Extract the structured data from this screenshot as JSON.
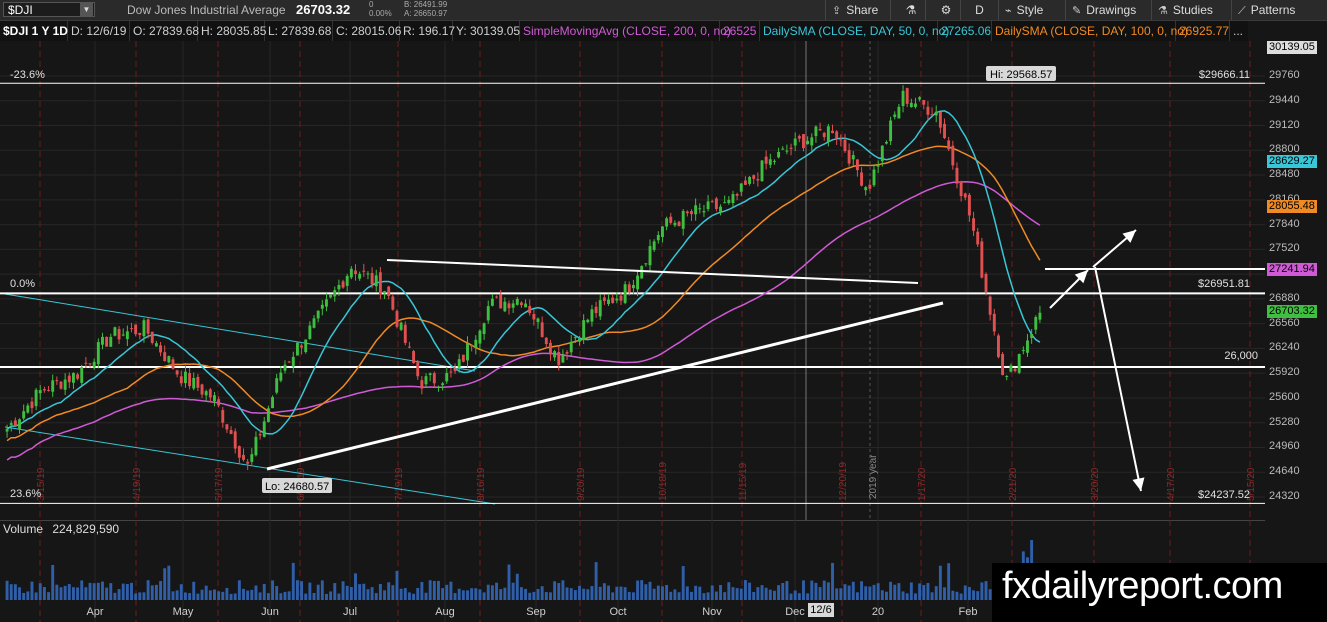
{
  "toolbar": {
    "symbol": "$DJI",
    "name": "Dow Jones Industrial Average",
    "last": "26703.32",
    "change": "0",
    "change_pct": "0.00%",
    "bid": "B: 26491.99",
    "ask": "A: 26650.97",
    "share": "Share",
    "timeframe": "D",
    "style": "Style",
    "drawings": "Drawings",
    "studies": "Studies",
    "patterns": "Patterns"
  },
  "infobar": {
    "title": "$DJI 1 Y 1D",
    "date": "D: 12/6/19",
    "open": "O: 27839.68",
    "high": "H: 28035.85",
    "low": "L: 27839.68",
    "close": "C: 28015.06",
    "range": "R: 196.17",
    "y": "Y: 30139.05",
    "sma200_label": "SimpleMovingAvg (CLOSE, 200, 0, no)",
    "sma200_value": "26525",
    "sma50_label": "DailySMA (CLOSE, DAY, 50, 0, no)",
    "sma50_value": "27265.06",
    "sma100_label": "DailySMA (CLOSE, DAY, 100, 0, no)",
    "sma100_value": "26925.77",
    "more": "..."
  },
  "price_axis": {
    "top_label": "30139.05",
    "ticks": [
      "29760",
      "29440",
      "29120",
      "28800",
      "28480",
      "28160",
      "27840",
      "27520",
      "27200",
      "26880",
      "26560",
      "26240",
      "25920",
      "25600",
      "25280",
      "24960",
      "24640",
      "24320"
    ],
    "sma50_tag": "28629.27",
    "sma100_tag": "28055.48",
    "sma200_tag": "27241.94",
    "last_tag": "26703.32"
  },
  "annotations": {
    "fib_top_pct": "-23.6%",
    "fib_top_val": "$29666.11",
    "fib_zero_pct": "0.0%",
    "fib_zero_val": "$26951.81",
    "level_26000": "26,000",
    "fib_bottom_pct": "23.6%",
    "fib_bottom_val": "$24237.52",
    "hi": "Hi: 29568.57",
    "lo": "Lo: 24680.57",
    "year_marker": "2019 year"
  },
  "expiry_dates": [
    "3/15/19",
    "4/19/19",
    "5/17/19",
    "6/21/19",
    "7/19/19",
    "8/16/19",
    "9/20/19",
    "10/18/19",
    "11/15/19",
    "12/20/19",
    "1/17/20",
    "2/21/20",
    "3/20/20",
    "4/17/20",
    "5/15/20"
  ],
  "months": [
    "Apr",
    "May",
    "Jun",
    "Jul",
    "Aug",
    "Sep",
    "Oct",
    "Nov",
    "Dec",
    "20",
    "Feb"
  ],
  "volume": {
    "label": "Volume",
    "value": "224,829,590"
  },
  "cursor_date": "12/6",
  "brand": "fxdailyreport.com",
  "colors": {
    "up": "#3fbf3f",
    "down": "#e05050",
    "sma50": "#39c6d6",
    "sma100": "#f08a24",
    "sma200": "#d05ad6",
    "trend": "#ffffff",
    "channel": "#39c6d6",
    "grid_red": "#6b1f1f"
  },
  "chart_data": {
    "type": "candlestick",
    "title": "$DJI 1 Y 1D",
    "ylim": [
      24200,
      30200
    ],
    "x": [
      "2019-02-27",
      "2019-03-13",
      "2019-03-27",
      "2019-04-10",
      "2019-04-24",
      "2019-05-08",
      "2019-05-22",
      "2019-06-03",
      "2019-06-17",
      "2019-07-01",
      "2019-07-15",
      "2019-07-29",
      "2019-08-12",
      "2019-08-26",
      "2019-09-09",
      "2019-09-23",
      "2019-10-03",
      "2019-10-17",
      "2019-10-31",
      "2019-11-14",
      "2019-11-28",
      "2019-12-12",
      "2019-12-26",
      "2020-01-09",
      "2020-01-23",
      "2020-02-06",
      "2020-02-12",
      "2020-02-20",
      "2020-02-24",
      "2020-02-27",
      "2020-03-02"
    ],
    "close": [
      25200,
      25700,
      25900,
      26400,
      26500,
      25900,
      25600,
      24700,
      26000,
      26600,
      27300,
      27000,
      25800,
      25900,
      26800,
      26900,
      26100,
      26700,
      27000,
      27800,
      28000,
      28100,
      28600,
      28900,
      29100,
      28300,
      29500,
      29300,
      27900,
      25800,
      26703
    ],
    "series": [
      {
        "name": "SimpleMovingAvg (CLOSE, 200, 0, no)",
        "last": 27241.94
      },
      {
        "name": "DailySMA (CLOSE, DAY, 50, 0, no)",
        "last": 28629.27
      },
      {
        "name": "DailySMA (CLOSE, DAY, 100, 0, no)",
        "last": 28055.48
      }
    ],
    "levels": {
      "fib_minus_23_6": 29666.11,
      "fib_0": 26951.81,
      "round": 26000,
      "fib_23_6": 24237.52,
      "hi": 29568.57,
      "lo": 24680.57
    }
  }
}
